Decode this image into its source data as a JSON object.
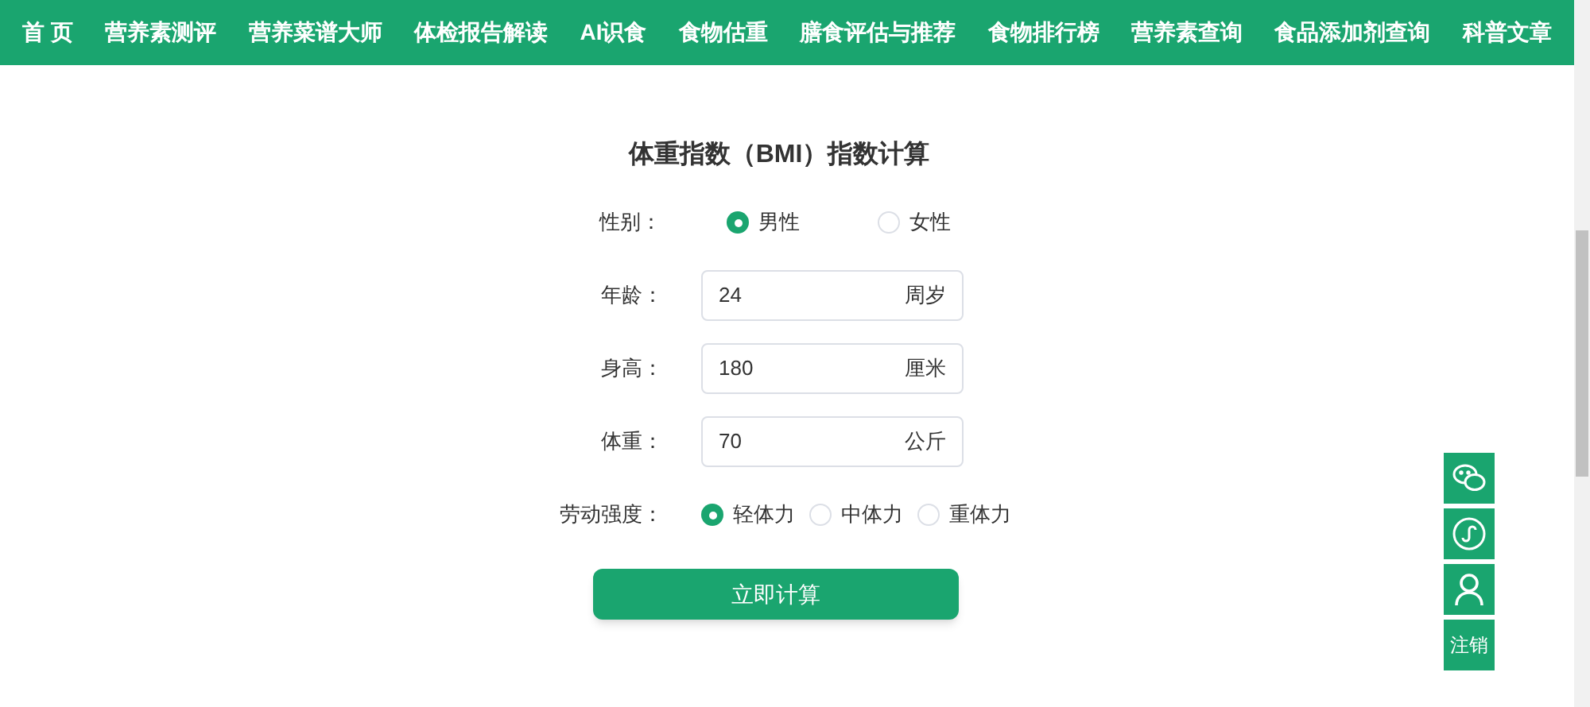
{
  "nav": [
    {
      "label": "首 页"
    },
    {
      "label": "营养素测评"
    },
    {
      "label": "营养菜谱大师"
    },
    {
      "label": "体检报告解读"
    },
    {
      "label": "AI识食"
    },
    {
      "label": "食物估重"
    },
    {
      "label": "膳食评估与推荐"
    },
    {
      "label": "食物排行榜"
    },
    {
      "label": "营养素查询"
    },
    {
      "label": "食品添加剂查询"
    },
    {
      "label": "科普文章"
    }
  ],
  "form": {
    "title": "体重指数（BMI）指数计算",
    "rows": [
      {
        "kind": "radio",
        "label": "性别：",
        "options": [
          {
            "label": "男性",
            "selected": true
          },
          {
            "label": "女性",
            "selected": false
          }
        ]
      },
      {
        "kind": "input",
        "label": "年龄：",
        "value": "24",
        "unit": "周岁"
      },
      {
        "kind": "input",
        "label": "身高：",
        "value": "180",
        "unit": "厘米"
      },
      {
        "kind": "input",
        "label": "体重：",
        "value": "70",
        "unit": "公斤"
      },
      {
        "kind": "radio",
        "label": "劳动强度：",
        "options": [
          {
            "label": "轻体力",
            "selected": true
          },
          {
            "label": "中体力",
            "selected": false
          },
          {
            "label": "重体力",
            "selected": false
          }
        ]
      }
    ],
    "submit": "立即计算"
  },
  "side_buttons": [
    {
      "kind": "chat"
    },
    {
      "kind": "mini-program"
    },
    {
      "kind": "user"
    },
    {
      "kind": "text",
      "label": "注销"
    }
  ]
}
